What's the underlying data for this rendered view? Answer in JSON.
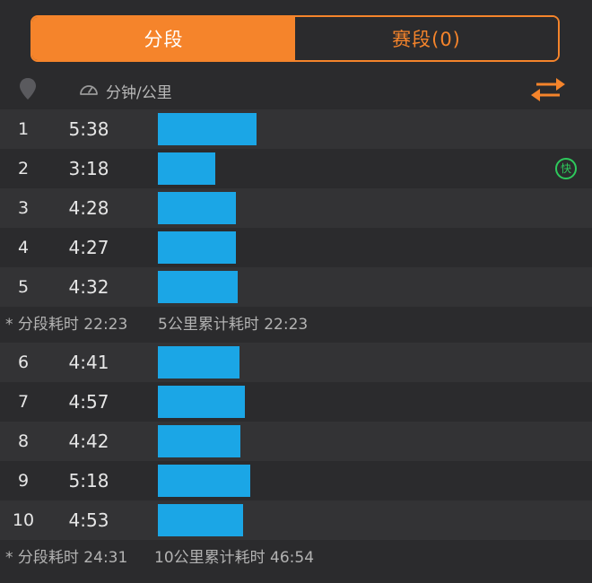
{
  "tabs": {
    "segment": "分段",
    "race": "赛段(0)"
  },
  "header": {
    "pace_label": "分钟/公里"
  },
  "colors": {
    "accent": "#f5842b",
    "bar": "#1ba6e6",
    "fast_badge": "#2ec95c"
  },
  "groups": [
    {
      "splits": [
        {
          "km": "1",
          "pace": "5:38",
          "seconds": 338,
          "fast": false
        },
        {
          "km": "2",
          "pace": "3:18",
          "seconds": 198,
          "fast": true
        },
        {
          "km": "3",
          "pace": "4:28",
          "seconds": 268,
          "fast": false
        },
        {
          "km": "4",
          "pace": "4:27",
          "seconds": 267,
          "fast": false
        },
        {
          "km": "5",
          "pace": "4:32",
          "seconds": 272,
          "fast": false
        }
      ],
      "summary_left": "* 分段耗时 22:23",
      "summary_right": "5公里累计耗时 22:23"
    },
    {
      "splits": [
        {
          "km": "6",
          "pace": "4:41",
          "seconds": 281,
          "fast": false
        },
        {
          "km": "7",
          "pace": "4:57",
          "seconds": 297,
          "fast": false
        },
        {
          "km": "8",
          "pace": "4:42",
          "seconds": 282,
          "fast": false
        },
        {
          "km": "9",
          "pace": "5:18",
          "seconds": 318,
          "fast": false
        },
        {
          "km": "10",
          "pace": "4:53",
          "seconds": 293,
          "fast": false
        }
      ],
      "summary_left": "* 分段耗时 24:31",
      "summary_right": "10公里累计耗时 46:54"
    }
  ],
  "fast_badge_label": "快"
}
